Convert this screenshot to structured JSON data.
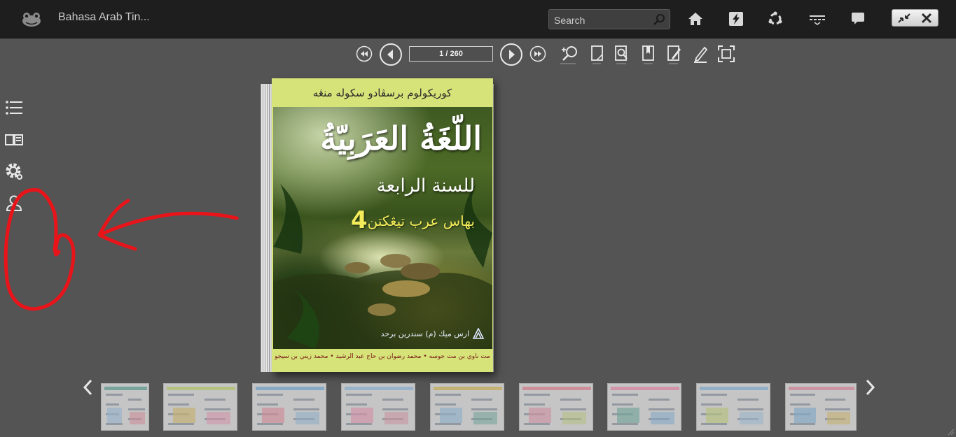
{
  "app": {
    "title": "Bahasa Arab Tin...",
    "icon": "frog-icon"
  },
  "search": {
    "placeholder": "Search",
    "icon": "search-icon"
  },
  "topbar_icons": [
    "home-icon",
    "flash-icon",
    "share-icon",
    "layout-icon",
    "comment-icon"
  ],
  "window_buttons": [
    "shrink-icon",
    "close-icon"
  ],
  "navigation": {
    "page_indicator": "1 / 260",
    "buttons": [
      "first-page",
      "previous-page",
      "next-page",
      "last-page"
    ],
    "tools": [
      "zoom-in-icon",
      "single-page-icon",
      "search-page-icon",
      "bookmark-icon",
      "note-icon",
      "highlight-icon",
      "fullscreen-icon"
    ]
  },
  "sidebar": {
    "items": [
      "table-of-contents-icon",
      "book-view-icon",
      "settings-icon",
      "user-icon"
    ]
  },
  "book_cover": {
    "header": "كوريكولوم برسڤادو سكوله منڠه",
    "title": "اللّغَةُ العَرَبِيّةُ",
    "subtitle": "للسنة الرابعة",
    "series": "بهاس عرب تيڠكتن",
    "number": "4",
    "publisher": "ارس ميك (م) سندرين برحد",
    "authors": "مت ناوي بن مت جوسه  •  محمد رضوان بن حاج عبد الرشيد  •  محمد زيني بن سيجو"
  },
  "thumbnails": {
    "count": 9,
    "prev_icon": "chevron-left-icon",
    "next_icon": "chevron-right-icon"
  },
  "colors": {
    "topbar": "#1e1e1e",
    "background": "#545454",
    "cover_green": "#d6e378",
    "annotation": "#e8141a"
  }
}
